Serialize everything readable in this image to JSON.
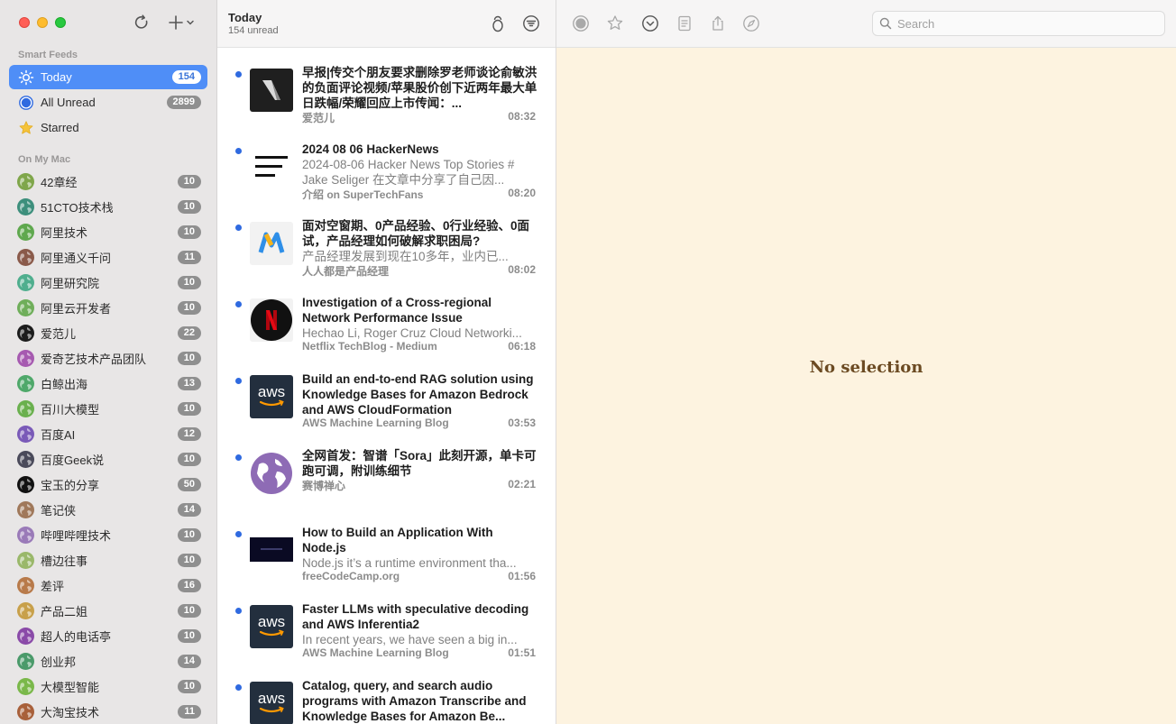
{
  "sidebar": {
    "smart_feeds_label": "Smart Feeds",
    "smart_items": [
      {
        "label": "Today",
        "count": "154",
        "icon": "sun-icon"
      },
      {
        "label": "All Unread",
        "count": "2899",
        "icon": "unread-circle-icon"
      },
      {
        "label": "Starred",
        "count": "",
        "icon": "star-icon"
      }
    ],
    "on_my_mac_label": "On My Mac",
    "feeds": [
      {
        "label": "42章经",
        "count": "10",
        "color": "#7fa64a"
      },
      {
        "label": "51CTO技术栈",
        "count": "10",
        "color": "#3d8f7c"
      },
      {
        "label": "阿里技术",
        "count": "10",
        "color": "#5fa84e"
      },
      {
        "label": "阿里通义千问",
        "count": "11",
        "color": "#8a5a4a"
      },
      {
        "label": "阿里研究院",
        "count": "10",
        "color": "#4fae8e"
      },
      {
        "label": "阿里云开发者",
        "count": "10",
        "color": "#6fae5a"
      },
      {
        "label": "爱范儿",
        "count": "22",
        "color": "#1c1c1c"
      },
      {
        "label": "爱奇艺技术产品团队",
        "count": "10",
        "color": "#a65ab0"
      },
      {
        "label": "白鲸出海",
        "count": "13",
        "color": "#4fa86a"
      },
      {
        "label": "百川大模型",
        "count": "10",
        "color": "#6ab04e"
      },
      {
        "label": "百度AI",
        "count": "12",
        "color": "#7a5ab8"
      },
      {
        "label": "百度Geek说",
        "count": "10",
        "color": "#4a4a5a"
      },
      {
        "label": "宝玉的分享",
        "count": "50",
        "color": "#111111"
      },
      {
        "label": "笔记侠",
        "count": "14",
        "color": "#a0785a"
      },
      {
        "label": "哔哩哔哩技术",
        "count": "10",
        "color": "#9a7ab8"
      },
      {
        "label": "槽边往事",
        "count": "10",
        "color": "#9ab86a"
      },
      {
        "label": "差评",
        "count": "16",
        "color": "#b87a4a"
      },
      {
        "label": "产品二姐",
        "count": "10",
        "color": "#c8a04a"
      },
      {
        "label": "超人的电话亭",
        "count": "10",
        "color": "#8a4aa8"
      },
      {
        "label": "创业邦",
        "count": "14",
        "color": "#4a9a6a"
      },
      {
        "label": "大模型智能",
        "count": "10",
        "color": "#7ab84a"
      },
      {
        "label": "大淘宝技术",
        "count": "11",
        "color": "#a8603a"
      }
    ]
  },
  "timeline": {
    "title": "Today",
    "subtitle": "154 unread",
    "articles": [
      {
        "title": "早报|传交个朋友要求删除罗老师谈论俞敏洪的负面评论视频/苹果股价创下近两年最大单日跌幅/荣耀回应上市传闻：...",
        "summary": "",
        "source": "爱范儿",
        "time": "08:32"
      },
      {
        "title": "2024 08 06 HackerNews",
        "summary": "2024-08-06 Hacker News Top Stories # Jake Seliger 在文章中分享了自己因...",
        "source": "介绍 on SuperTechFans",
        "time": "08:20"
      },
      {
        "title": "面对空窗期、0产品经验、0行业经验、0面试，产品经理如何破解求职困局?",
        "summary": "产品经理发展到现在10多年，业内已...",
        "source": "人人都是产品经理",
        "time": "08:02"
      },
      {
        "title": "Investigation of a Cross-regional Network Performance Issue",
        "summary": "Hechao Li, Roger Cruz Cloud Networki...",
        "source": "Netflix TechBlog - Medium",
        "time": "06:18"
      },
      {
        "title": "Build an end-to-end RAG solution using Knowledge Bases for Amazon Bedrock and AWS CloudFormation",
        "summary": "",
        "source": "AWS Machine Learning Blog",
        "time": "03:53"
      },
      {
        "title": "全网首发：智谱「Sora」此刻开源，单卡可跑可调，附训练细节",
        "summary": "",
        "source": "赛博禅心",
        "time": "02:21"
      },
      {
        "title": "How to Build an Application With Node.js",
        "summary": "Node.js it’s a runtime environment tha...",
        "source": "freeCodeCamp.org",
        "time": "01:56"
      },
      {
        "title": "Faster LLMs with speculative decoding and AWS Inferentia2",
        "summary": "In recent years, we have seen a big in...",
        "source": "AWS Machine Learning Blog",
        "time": "01:51"
      },
      {
        "title": "Catalog, query, and search audio programs with Amazon Transcribe and Knowledge Bases for Amazon Be...",
        "summary": "",
        "source": "",
        "time": ""
      }
    ]
  },
  "detail": {
    "search_placeholder": "Search",
    "empty_text": "No selection"
  },
  "thumb_texts": {
    "aws": "aws"
  }
}
